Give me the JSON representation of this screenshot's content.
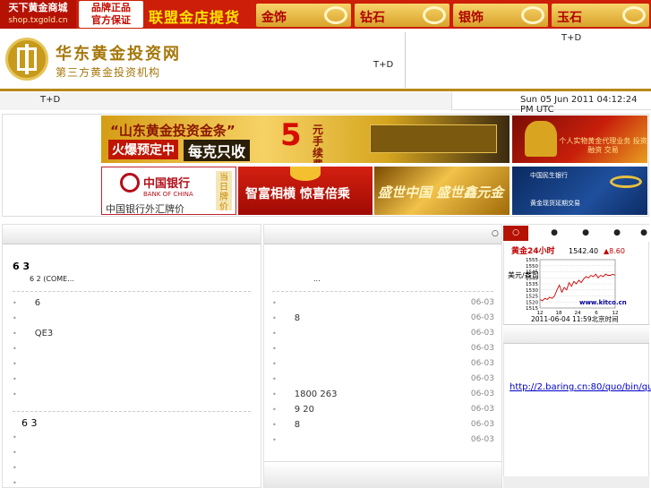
{
  "top_banner": {
    "shop_name": "天下黄金商城",
    "shop_url": "shop.txgold.cn",
    "brand_line1": "品牌正品",
    "brand_line2": "官方保证",
    "union_text": "联盟金店提货",
    "categories": [
      "金饰",
      "钻石",
      "银饰",
      "玉石"
    ]
  },
  "header": {
    "site_name": "华东黄金投资网",
    "site_subtitle": "第三方黄金投资机构",
    "td_label_1": "T+D",
    "td_label_2": "T+D"
  },
  "nav": {
    "td_label": "T+D",
    "datetime": "Sun 05 Jun 2011 04:12:24 PM UTC"
  },
  "ads": {
    "shandong": {
      "headline": "“山东黄金投资金条”",
      "hot": "火爆预定中",
      "per_gram": "每克只收",
      "five": "5",
      "fee": "元手续费"
    },
    "personal": {
      "text": "个人实物黄金代理业务 投资 融资 交易"
    },
    "boc": {
      "name_cn": "中国银行",
      "name_en": "BANK OF CHINA",
      "caption": "中国银行外汇牌价",
      "stamp": "当日牌价"
    },
    "wisdom": {
      "text": "智富相横 惊喜倍乘"
    },
    "shengshi": {
      "text": "盛世中国 盛世鑫元金"
    },
    "minsheng": {
      "bank": "中国民生银行",
      "promo": "黄金现货延期交易"
    }
  },
  "left_column": {
    "lead_title": "6 3",
    "lead_sub": "6 2        (COME...",
    "items": [
      "6",
      "",
      "QE3",
      "",
      "",
      "",
      ""
    ],
    "lead2_title": "6 3",
    "items2": [
      "",
      "",
      "",
      ""
    ]
  },
  "mid_column": {
    "marker": "○",
    "lead_sub": "...",
    "items": [
      {
        "text": "",
        "date": "06-03"
      },
      {
        "text": "8",
        "date": "06-03"
      },
      {
        "text": "",
        "date": "06-03"
      },
      {
        "text": "",
        "date": "06-03"
      },
      {
        "text": "",
        "date": "06-03"
      },
      {
        "text": "",
        "date": "06-03"
      },
      {
        "text": "1800        263",
        "date": "06-03"
      },
      {
        "text": "9 20",
        "date": "06-03"
      },
      {
        "text": "8",
        "date": "06-03"
      },
      {
        "text": "",
        "date": "06-03"
      }
    ]
  },
  "right_column": {
    "tabs": [
      "○",
      "●",
      "●",
      "●",
      "●"
    ],
    "quote_link": "http://2.baring.cn:80/quo/bin/quot"
  },
  "kitco": {
    "title": "黄金24小时",
    "price": "1542.40",
    "change": "▲8.60",
    "unit": "美元/盎司",
    "site": "www.kitco.cn",
    "timestamp": "2011-06-04 11:59北京时间",
    "ylim": [
      1515,
      1555
    ],
    "yticks": [
      "1555",
      "1550",
      "1545",
      "1540",
      "1535",
      "1530",
      "1525",
      "1520",
      "1515"
    ],
    "xticks": [
      "12",
      "18",
      "24",
      "6",
      "12"
    ],
    "series": [
      1522,
      1521,
      1523,
      1522,
      1524,
      1523,
      1525,
      1530,
      1534,
      1528,
      1532,
      1530,
      1536,
      1533,
      1537,
      1535,
      1538,
      1536,
      1539,
      1541,
      1540,
      1542,
      1541,
      1543,
      1540,
      1542,
      1541,
      1543,
      1542,
      1542,
      1543,
      1542
    ]
  }
}
